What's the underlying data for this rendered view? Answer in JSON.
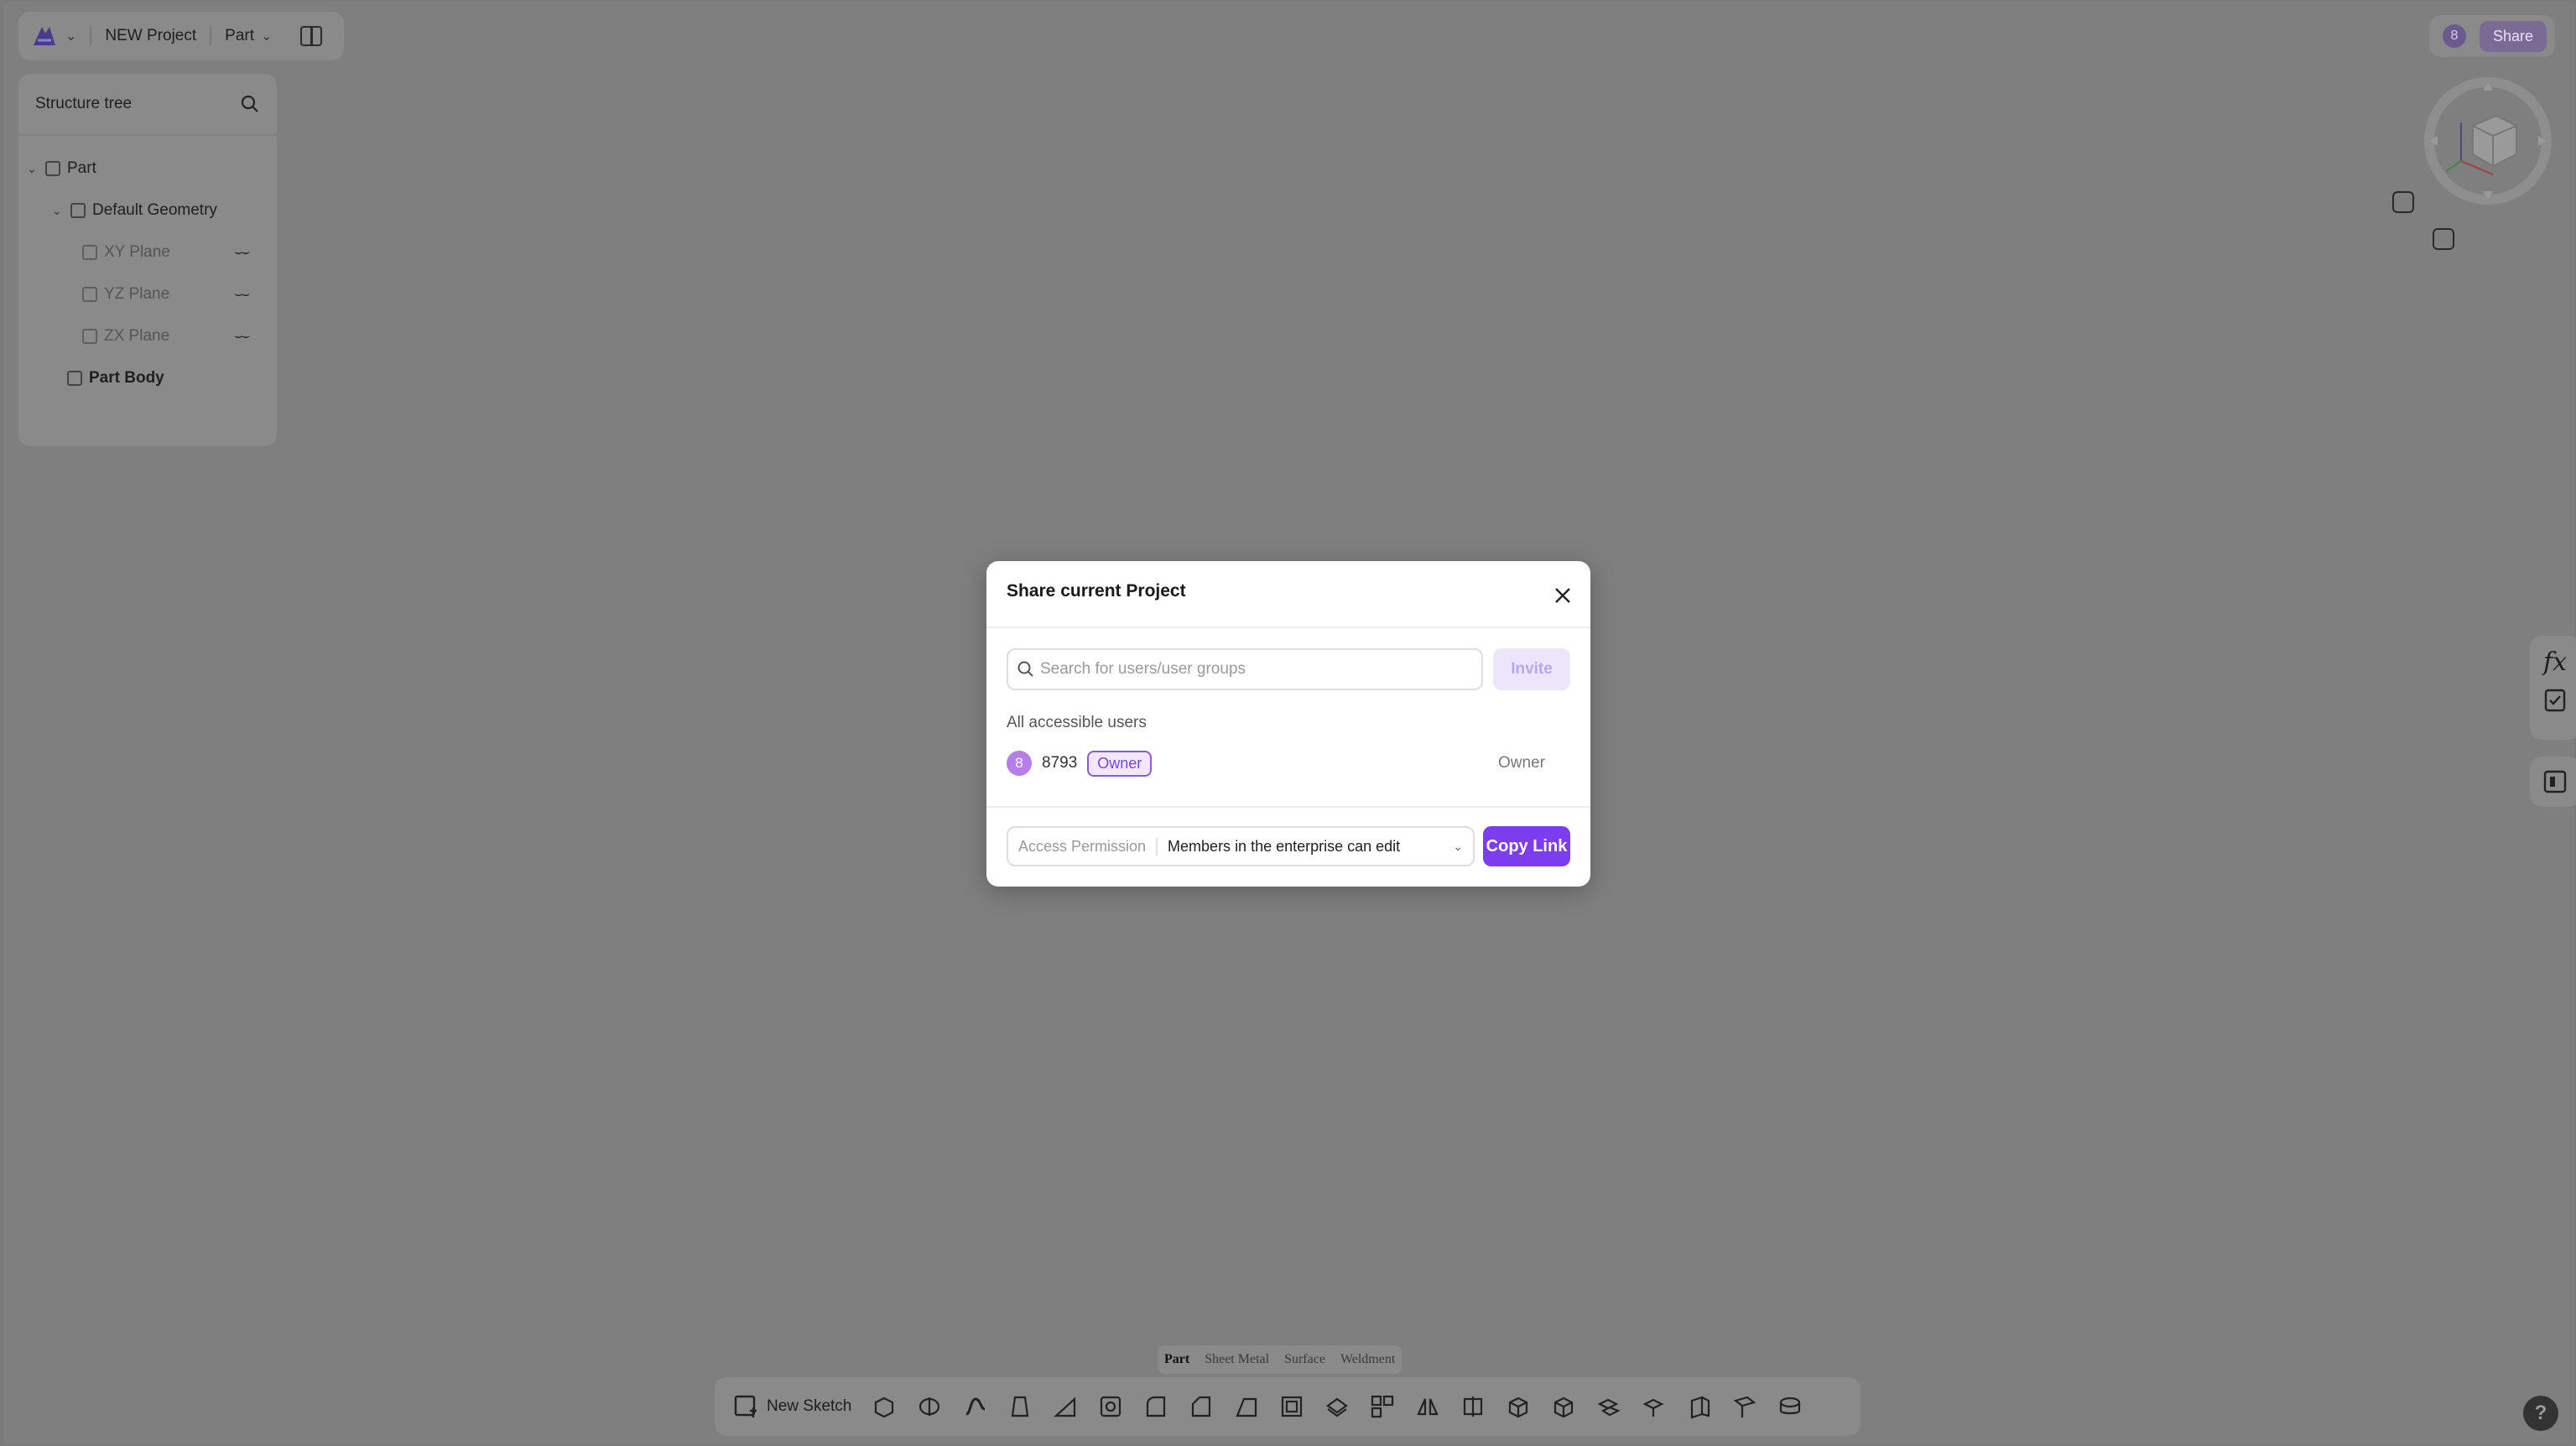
{
  "header": {
    "project_name": "NEW Project",
    "mode_label": "Part",
    "share_avatar": "8",
    "share_label": "Share"
  },
  "tree": {
    "title": "Structure tree",
    "nodes": [
      {
        "label": "Part",
        "icon": "part-icon"
      },
      {
        "label": "Default Geometry",
        "icon": "geometry-icon"
      },
      {
        "label": "XY Plane",
        "icon": "plane-icon",
        "hidden": true
      },
      {
        "label": "YZ Plane",
        "icon": "plane-icon",
        "hidden": true
      },
      {
        "label": "ZX Plane",
        "icon": "plane-icon",
        "hidden": true
      },
      {
        "label": "Part Body",
        "icon": "body-icon"
      }
    ]
  },
  "modes": {
    "tabs": [
      "Part",
      "Sheet Metal",
      "Surface",
      "Weldment"
    ],
    "active": "Part"
  },
  "toolbar": {
    "new_sketch": "New Sketch"
  },
  "modal": {
    "title": "Share current Project",
    "search_placeholder": "Search for users/user groups",
    "invite_label": "Invite",
    "users_label": "All accessible users",
    "users": [
      {
        "avatar": "8",
        "name": "8793",
        "badge": "Owner",
        "role": "Owner"
      }
    ],
    "permission_label": "Access Permission",
    "permission_value": "Members in the enterprise can edit",
    "copy_link_label": "Copy Link"
  },
  "right_tools": {
    "fx_label": "fx"
  },
  "help_label": "?",
  "colors": {
    "accent": "#7c3cf0",
    "overlay": "#7f7f7f",
    "badge_border": "#8a5ad8"
  }
}
